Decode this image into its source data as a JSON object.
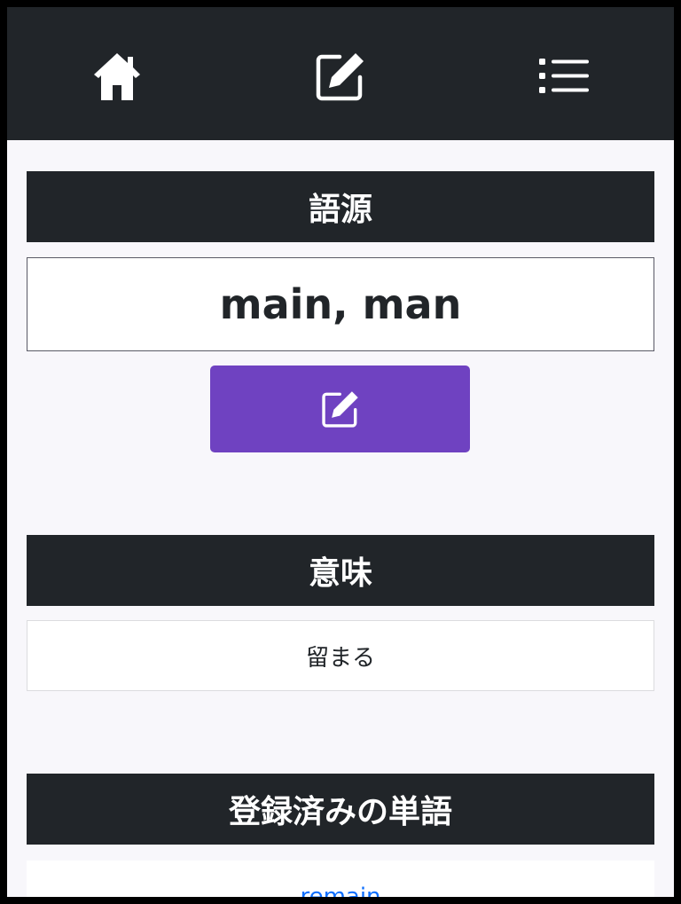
{
  "navbar": {
    "icons": [
      "home-icon",
      "edit-icon",
      "list-icon"
    ]
  },
  "etymology": {
    "header": "語源",
    "value": "main, man",
    "edit_icon": "edit-icon",
    "button_color": "#6f42c1"
  },
  "meaning": {
    "header": "意味",
    "value": "留まる"
  },
  "registered_words": {
    "header": "登録済みの単語",
    "items": [
      "remain"
    ]
  },
  "colors": {
    "header_bg": "#212529",
    "page_bg": "#f8f7fb",
    "link": "#0d6efd"
  }
}
